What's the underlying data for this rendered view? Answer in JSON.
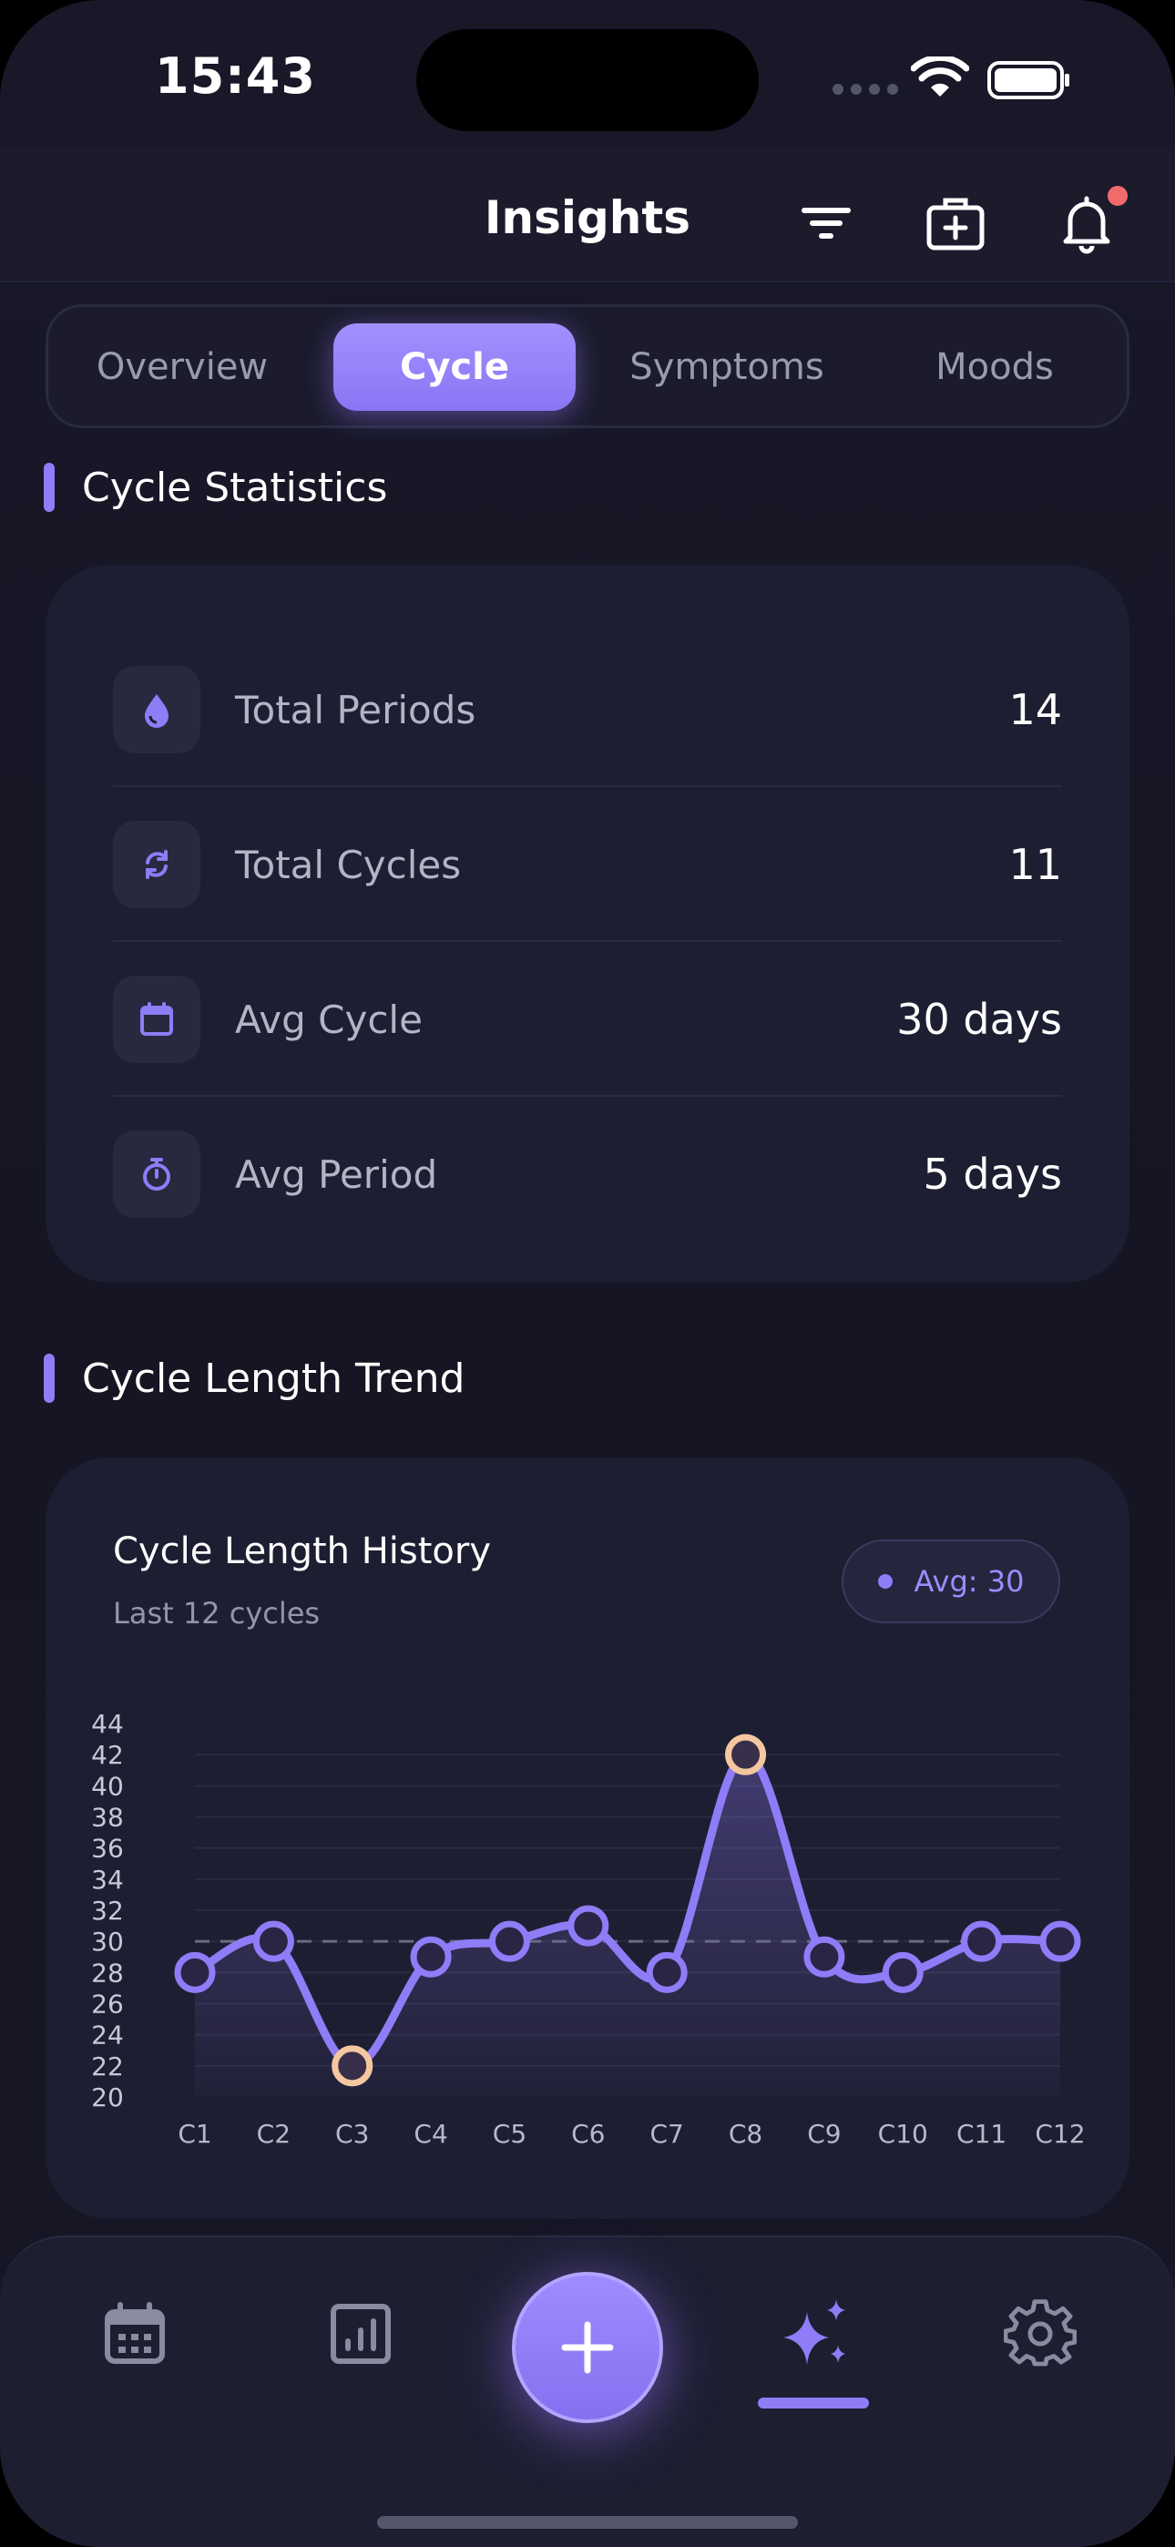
{
  "status_bar": {
    "time": "15:43"
  },
  "header": {
    "title": "Insights",
    "icons": [
      "filter-icon",
      "medical-kit-icon",
      "bell-icon"
    ]
  },
  "tabs": [
    {
      "label": "Overview",
      "active": false
    },
    {
      "label": "Cycle",
      "active": true
    },
    {
      "label": "Symptoms",
      "active": false
    },
    {
      "label": "Moods",
      "active": false
    }
  ],
  "stats": {
    "section_title": "Cycle Statistics",
    "rows": [
      {
        "icon": "drop-icon",
        "label": "Total Periods",
        "value": "14"
      },
      {
        "icon": "sync-icon",
        "label": "Total Cycles",
        "value": "11"
      },
      {
        "icon": "calendar-icon",
        "label": "Avg Cycle",
        "value": "30 days"
      },
      {
        "icon": "timer-icon",
        "label": "Avg Period",
        "value": "5 days"
      }
    ]
  },
  "trend": {
    "section_title": "Cycle Length Trend",
    "card_title": "Cycle Length History",
    "card_subtitle": "Last 12 cycles",
    "avg_badge": "Avg: 30"
  },
  "chart_data": {
    "type": "line",
    "categories": [
      "C1",
      "C2",
      "C3",
      "C4",
      "C5",
      "C6",
      "C7",
      "C8",
      "C9",
      "C10",
      "C11",
      "C12"
    ],
    "values": [
      28,
      30,
      22,
      29,
      30,
      31,
      28,
      42,
      29,
      28,
      30,
      30
    ],
    "highlighted": [
      "C3",
      "C8"
    ],
    "average": 30,
    "ylim": [
      20,
      44
    ],
    "yticks": [
      20,
      22,
      24,
      26,
      28,
      30,
      32,
      34,
      36,
      38,
      40,
      42,
      44
    ],
    "grid": true,
    "colors": {
      "line": "#8f7cf7",
      "highlight": "#f4c7a1",
      "average_line": "#6a6a84"
    }
  },
  "bottom_nav": {
    "items": [
      "calendar-icon",
      "chart-icon",
      "add-icon",
      "sparkle-icon",
      "gear-icon"
    ],
    "active": "sparkle-icon"
  }
}
